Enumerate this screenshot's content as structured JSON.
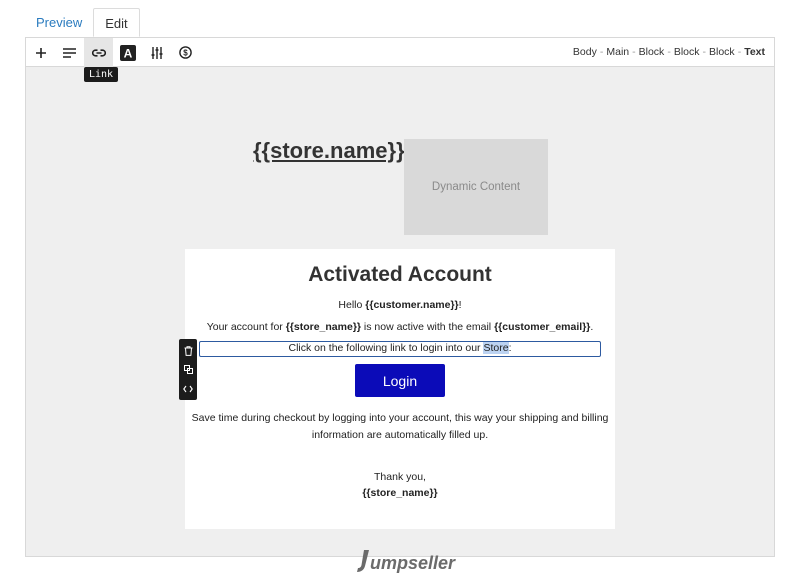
{
  "tabs": [
    {
      "label": "Preview"
    },
    {
      "label": "Edit"
    }
  ],
  "toolbar": {
    "tooltip": "Link"
  },
  "breadcrumb": {
    "items": [
      "Body",
      "Main",
      "Block",
      "Block",
      "Block"
    ],
    "current": "Text",
    "separator": "-"
  },
  "header": {
    "store_name": "{{store.name}}",
    "dynamic_content": "Dynamic Content"
  },
  "email": {
    "title": "Activated Account",
    "greeting_prefix": "Hello ",
    "greeting_var": "{{customer.name}}",
    "greeting_suffix": "!",
    "account_prefix": "Your account for ",
    "account_var1": "{{store_name}}",
    "account_mid": " is now active with the email ",
    "account_var2": "{{customer_email}}",
    "account_suffix": ".",
    "link_line_prefix": "Click on the following link to login into our ",
    "link_line_highlight": "Store",
    "link_line_suffix": ":",
    "login_button": "Login",
    "save_time_line1": "Save time during checkout by logging into your account, this way your shipping and billing",
    "save_time_line2": "information are automatically filled up.",
    "thanks": "Thank you,",
    "signature": "{{store_name}}"
  },
  "footer": {
    "logo_text": "umpseller"
  },
  "colors": {
    "accent_blue": "#0b0bb8",
    "selection_border": "#2d5aa0",
    "tab_link": "#2a7bbf"
  }
}
